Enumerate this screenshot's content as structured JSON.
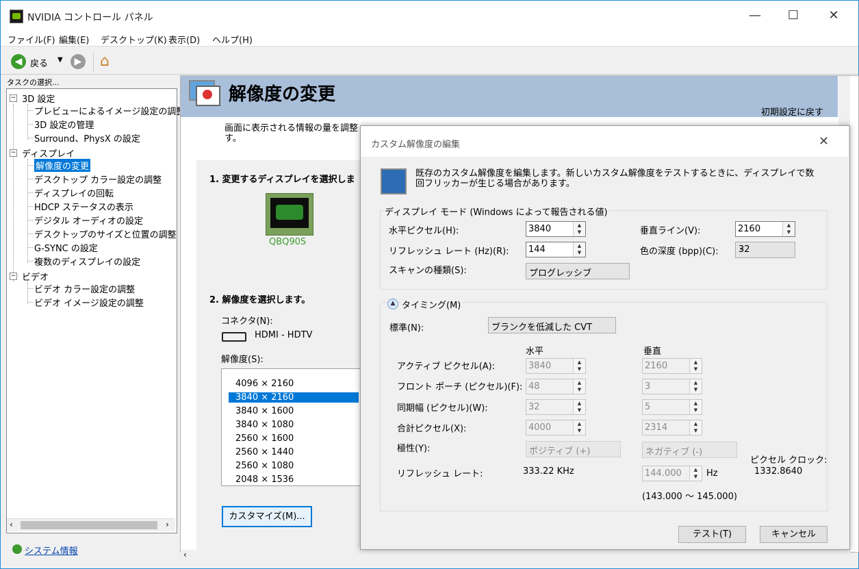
{
  "window": {
    "title": "NVIDIA コントロール パネル",
    "min": "—",
    "max": "☐",
    "close": "✕"
  },
  "menu": [
    "ファイル(F)",
    "編集(E)",
    "デスクトップ(K)",
    "表示(D)",
    "ヘルプ(H)"
  ],
  "toolbar": {
    "back_label": "戻る"
  },
  "sidebar": {
    "task_label": "タスクの選択...",
    "groups": [
      {
        "label": "3D 設定",
        "items": [
          "プレビューによるイメージ設定の調整",
          "3D 設定の管理",
          "Surround、PhysX の設定"
        ]
      },
      {
        "label": "ディスプレイ",
        "items": [
          "解像度の変更",
          "デスクトップ カラー設定の調整",
          "ディスプレイの回転",
          "HDCP ステータスの表示",
          "デジタル オーディオの設定",
          "デスクトップのサイズと位置の調整",
          "G-SYNC の設定",
          "複数のディスプレイの設定"
        ]
      },
      {
        "label": "ビデオ",
        "items": [
          "ビデオ カラー設定の調整",
          "ビデオ イメージ設定の調整"
        ]
      }
    ],
    "system_info": "システム情報"
  },
  "page": {
    "title": "解像度の変更",
    "restore_defaults": "初期設定に戻す",
    "description": "画面に表示される情報の量を調整す。",
    "step1": "1. 変更するディスプレイを選択しま",
    "display_name": "QBQ90S",
    "step2": "2. 解像度を選択します。",
    "connector_label": "コネクタ(N):",
    "connector_value": "HDMI - HDTV",
    "resolution_label": "解像度(S):",
    "resolutions": [
      "4096 × 2160",
      "3840 × 2160",
      "3840 × 1600",
      "3840 × 1080",
      "2560 × 1600",
      "2560 × 1440",
      "2560 × 1080",
      "2048 × 1536"
    ],
    "selected_resolution_index": 1,
    "customize_button": "カスタマイズ(M)..."
  },
  "dialog": {
    "title": "カスタム解像度の編集",
    "description": "既存のカスタム解像度を編集します。新しいカスタム解像度をテストするときに、ディスプレイで数回フリッカーが生じる場合があります。",
    "display_mode_group": "ディスプレイ モード (Windows によって報告される値)",
    "h_pixels_label": "水平ピクセル(H):",
    "h_pixels": "3840",
    "v_lines_label": "垂直ライン(V):",
    "v_lines": "2160",
    "refresh_label": "リフレッシュ レート (Hz)(R):",
    "refresh": "144",
    "color_depth_label": "色の深度 (bpp)(C):",
    "color_depth": "32",
    "scan_label": "スキャンの種類(S):",
    "scan": "プログレッシブ",
    "timing_label": "タイミング(M)",
    "standard_label": "標準(N):",
    "standard": "ブランクを低減した CVT",
    "col_horizontal": "水平",
    "col_vertical": "垂直",
    "active_label": "アクティブ ピクセル(A):",
    "active_h": "3840",
    "active_v": "2160",
    "front_label": "フロント ポーチ (ピクセル)(F):",
    "front_h": "48",
    "front_v": "3",
    "sync_label": "同期幅 (ピクセル)(W):",
    "sync_h": "32",
    "sync_v": "5",
    "total_label": "合計ピクセル(X):",
    "total_h": "4000",
    "total_v": "2314",
    "polarity_label": "極性(Y):",
    "polarity_h": "ポジティブ (+)",
    "polarity_v": "ネガティブ (-)",
    "refresh_rate_label": "リフレッシュ レート:",
    "refresh_khz": "333.22 KHz",
    "refresh_hz": "144.000",
    "hz_unit": "Hz",
    "refresh_range": "(143.000 ～ 145.000)",
    "pixel_clock_label": "ピクセル クロック:",
    "pixel_clock": "1332.8640",
    "test_button": "テスト(T)",
    "cancel_button": "キャンセル"
  }
}
